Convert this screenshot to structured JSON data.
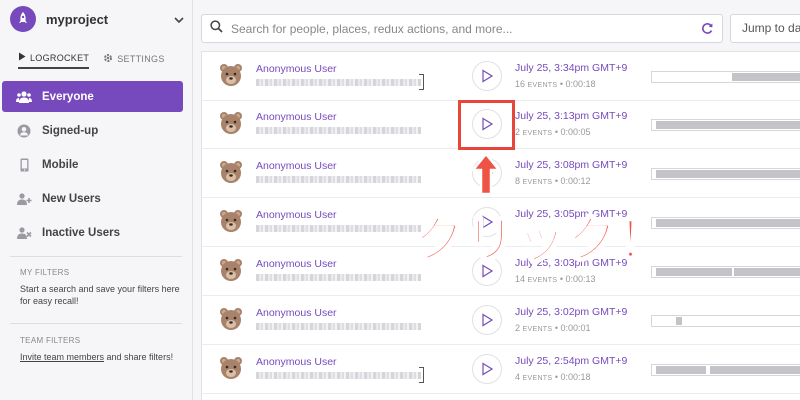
{
  "project": {
    "name": "myproject"
  },
  "tabs": [
    {
      "label": "LOGROCKET",
      "icon": "play-icon"
    },
    {
      "label": "SETTINGS",
      "icon": "gear-icon"
    }
  ],
  "nav": [
    {
      "label": "Everyone",
      "icon": "users-icon",
      "active": true
    },
    {
      "label": "Signed-up",
      "icon": "user-circle-icon",
      "active": false
    },
    {
      "label": "Mobile",
      "icon": "mobile-icon",
      "active": false
    },
    {
      "label": "New Users",
      "icon": "user-plus-icon",
      "active": false
    },
    {
      "label": "Inactive Users",
      "icon": "user-x-icon",
      "active": false
    }
  ],
  "my_filters": {
    "title": "MY FILTERS",
    "text": "Start a search and save your filters here for easy recall!"
  },
  "team_filters": {
    "title": "TEAM FILTERS",
    "link": "Invite team members",
    "text": " and share filters!"
  },
  "search": {
    "placeholder": "Search for people, places, redux actions, and more..."
  },
  "jump": {
    "label": "Jump to da"
  },
  "sessions": [
    {
      "user": "Anonymous User",
      "time": "July 25, 3:34pm GMT+9",
      "events": "16",
      "events_label": "EVENTS",
      "duration": "0:00:18"
    },
    {
      "user": "Anonymous User",
      "time": "July 25, 3:13pm GMT+9",
      "events": "2",
      "events_label": "EVENTS",
      "duration": "0:00:05"
    },
    {
      "user": "Anonymous User",
      "time": "July 25, 3:08pm GMT+9",
      "events": "8",
      "events_label": "EVENTS",
      "duration": "0:00:12"
    },
    {
      "user": "Anonymous User",
      "time": "July 25, 3:05pm GMT+9",
      "events": "",
      "events_label": "",
      "duration": ""
    },
    {
      "user": "Anonymous User",
      "time": "July 25, 3:03pm GMT+9",
      "events": "14",
      "events_label": "EVENTS",
      "duration": "0:00:13"
    },
    {
      "user": "Anonymous User",
      "time": "July 25, 3:02pm GMT+9",
      "events": "2",
      "events_label": "EVENTS",
      "duration": "0:00:01"
    },
    {
      "user": "Anonymous User",
      "time": "July 25, 2:54pm GMT+9",
      "events": "4",
      "events_label": "EVENTS",
      "duration": "0:00:18"
    }
  ],
  "annotation": {
    "text": "クリック！",
    "arrow": "↑"
  },
  "colors": {
    "accent": "#764abc",
    "annotation": "#e8463a"
  }
}
